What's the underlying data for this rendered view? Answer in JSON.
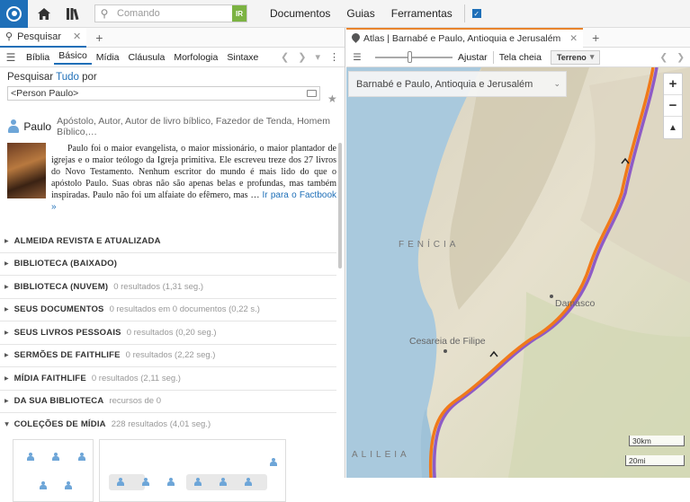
{
  "topbar": {
    "command_placeholder": "Comando",
    "go_label": "IR",
    "menu": [
      "Documentos",
      "Guias",
      "Ferramentas"
    ]
  },
  "left_panel": {
    "tab_title": "Pesquisar",
    "subtabs": [
      "Bíblia",
      "Básico",
      "Mídia",
      "Cláusula",
      "Morfologia",
      "Sintaxe"
    ],
    "active_subtab": "Básico",
    "search_prefix": "Pesquisar",
    "search_scope": "Tudo",
    "search_suffix": "por",
    "query": "<Person Paulo>",
    "factbook": {
      "title": "Paulo",
      "subtitle": "Apóstolo, Autor, Autor de livro bíblico, Fazedor de Tenda, Homem Bíblico,…",
      "text": "Paulo foi o maior evangelista, o maior missionário, o maior plantador de igrejas e o maior teólogo da Igreja primitiva. Ele escreveu treze dos 27 livros do Novo Testamento. Nenhum escritor do mundo é mais lido do que o apóstolo Paulo. Suas obras não são apenas belas e profundas, mas também inspiradas. Paulo não foi um alfaiate do efêmero, mas … ",
      "link": "Ir para o Factbook »"
    },
    "results": [
      {
        "name": "ALMEIDA REVISTA E ATUALIZADA",
        "meta": ""
      },
      {
        "name": "BIBLIOTECA (BAIXADO)",
        "meta": ""
      },
      {
        "name": "BIBLIOTECA (NUVEM)",
        "meta": "0 resultados (1,31 seg.)"
      },
      {
        "name": "SEUS DOCUMENTOS",
        "meta": "0 resultados em 0 documentos (0,22 s.)"
      },
      {
        "name": "SEUS LIVROS PESSOAIS",
        "meta": "0 resultados (0,20 seg.)"
      },
      {
        "name": "SERMÕES DE FAITHLIFE",
        "meta": "0 resultados (2,22 seg.)"
      },
      {
        "name": "MÍDIA FAITHLIFE",
        "meta": "0 resultados (2,11 seg.)"
      },
      {
        "name": "DA SUA BIBLIOTECA",
        "meta": "recursos de 0"
      },
      {
        "name": "COLEÇÕES DE MÍDIA",
        "meta": "228 resultados (4,01 seg.)"
      }
    ]
  },
  "right_panel": {
    "tab_title": "Atlas | Barnabé e Paulo, Antioquia e Jerusalém",
    "fit_label": "Ajustar",
    "fullscreen_label": "Tela cheia",
    "layer_label": "Terreno",
    "map_title": "Barnabé e Paulo, Antioquia e Jerusalém",
    "regions": [
      "FENÍCIA",
      "ALILEIA"
    ],
    "cities": [
      "Damasco",
      "Cesareia de Filipe"
    ],
    "scale": [
      "30km",
      "20mi"
    ],
    "colors": {
      "route_orange": "#f07a1a",
      "route_purple": "#8e5bc6"
    }
  }
}
